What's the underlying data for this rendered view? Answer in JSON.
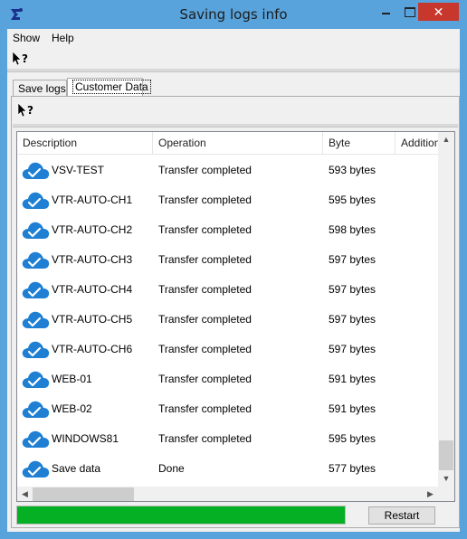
{
  "window": {
    "title": "Saving logs info",
    "close_glyph": "✕"
  },
  "menu": {
    "show": "Show",
    "help": "Help"
  },
  "tabs": [
    {
      "label": "Save logs"
    },
    {
      "label": "Customer Data"
    }
  ],
  "list": {
    "columns": [
      "Description",
      "Operation",
      "Byte",
      "Addition"
    ],
    "rows": [
      {
        "description": "VSV-TEST",
        "operation": "Transfer completed",
        "byte": "593 bytes"
      },
      {
        "description": "VTR-AUTO-CH1",
        "operation": "Transfer completed",
        "byte": "595 bytes"
      },
      {
        "description": "VTR-AUTO-CH2",
        "operation": "Transfer completed",
        "byte": "598 bytes"
      },
      {
        "description": "VTR-AUTO-CH3",
        "operation": "Transfer completed",
        "byte": "597 bytes"
      },
      {
        "description": "VTR-AUTO-CH4",
        "operation": "Transfer completed",
        "byte": "597 bytes"
      },
      {
        "description": "VTR-AUTO-CH5",
        "operation": "Transfer completed",
        "byte": "597 bytes"
      },
      {
        "description": "VTR-AUTO-CH6",
        "operation": "Transfer completed",
        "byte": "597 bytes"
      },
      {
        "description": "WEB-01",
        "operation": "Transfer completed",
        "byte": "591 bytes"
      },
      {
        "description": "WEB-02",
        "operation": "Transfer completed",
        "byte": "591 bytes"
      },
      {
        "description": "WINDOWS81",
        "operation": "Transfer completed",
        "byte": "595 bytes"
      },
      {
        "description": "Save data",
        "operation": "Done",
        "byte": "577 bytes"
      }
    ],
    "row_icon": "cloud-check-icon"
  },
  "progress": {
    "fraction": 1.0
  },
  "buttons": {
    "restart": "Restart"
  },
  "colors": {
    "titlebar": "#59a3dc",
    "close": "#c7372c",
    "progress": "#06b025",
    "cloud": "#1e7fd3"
  },
  "icons": {
    "app": "app-icon",
    "help": "help-cursor-icon"
  }
}
